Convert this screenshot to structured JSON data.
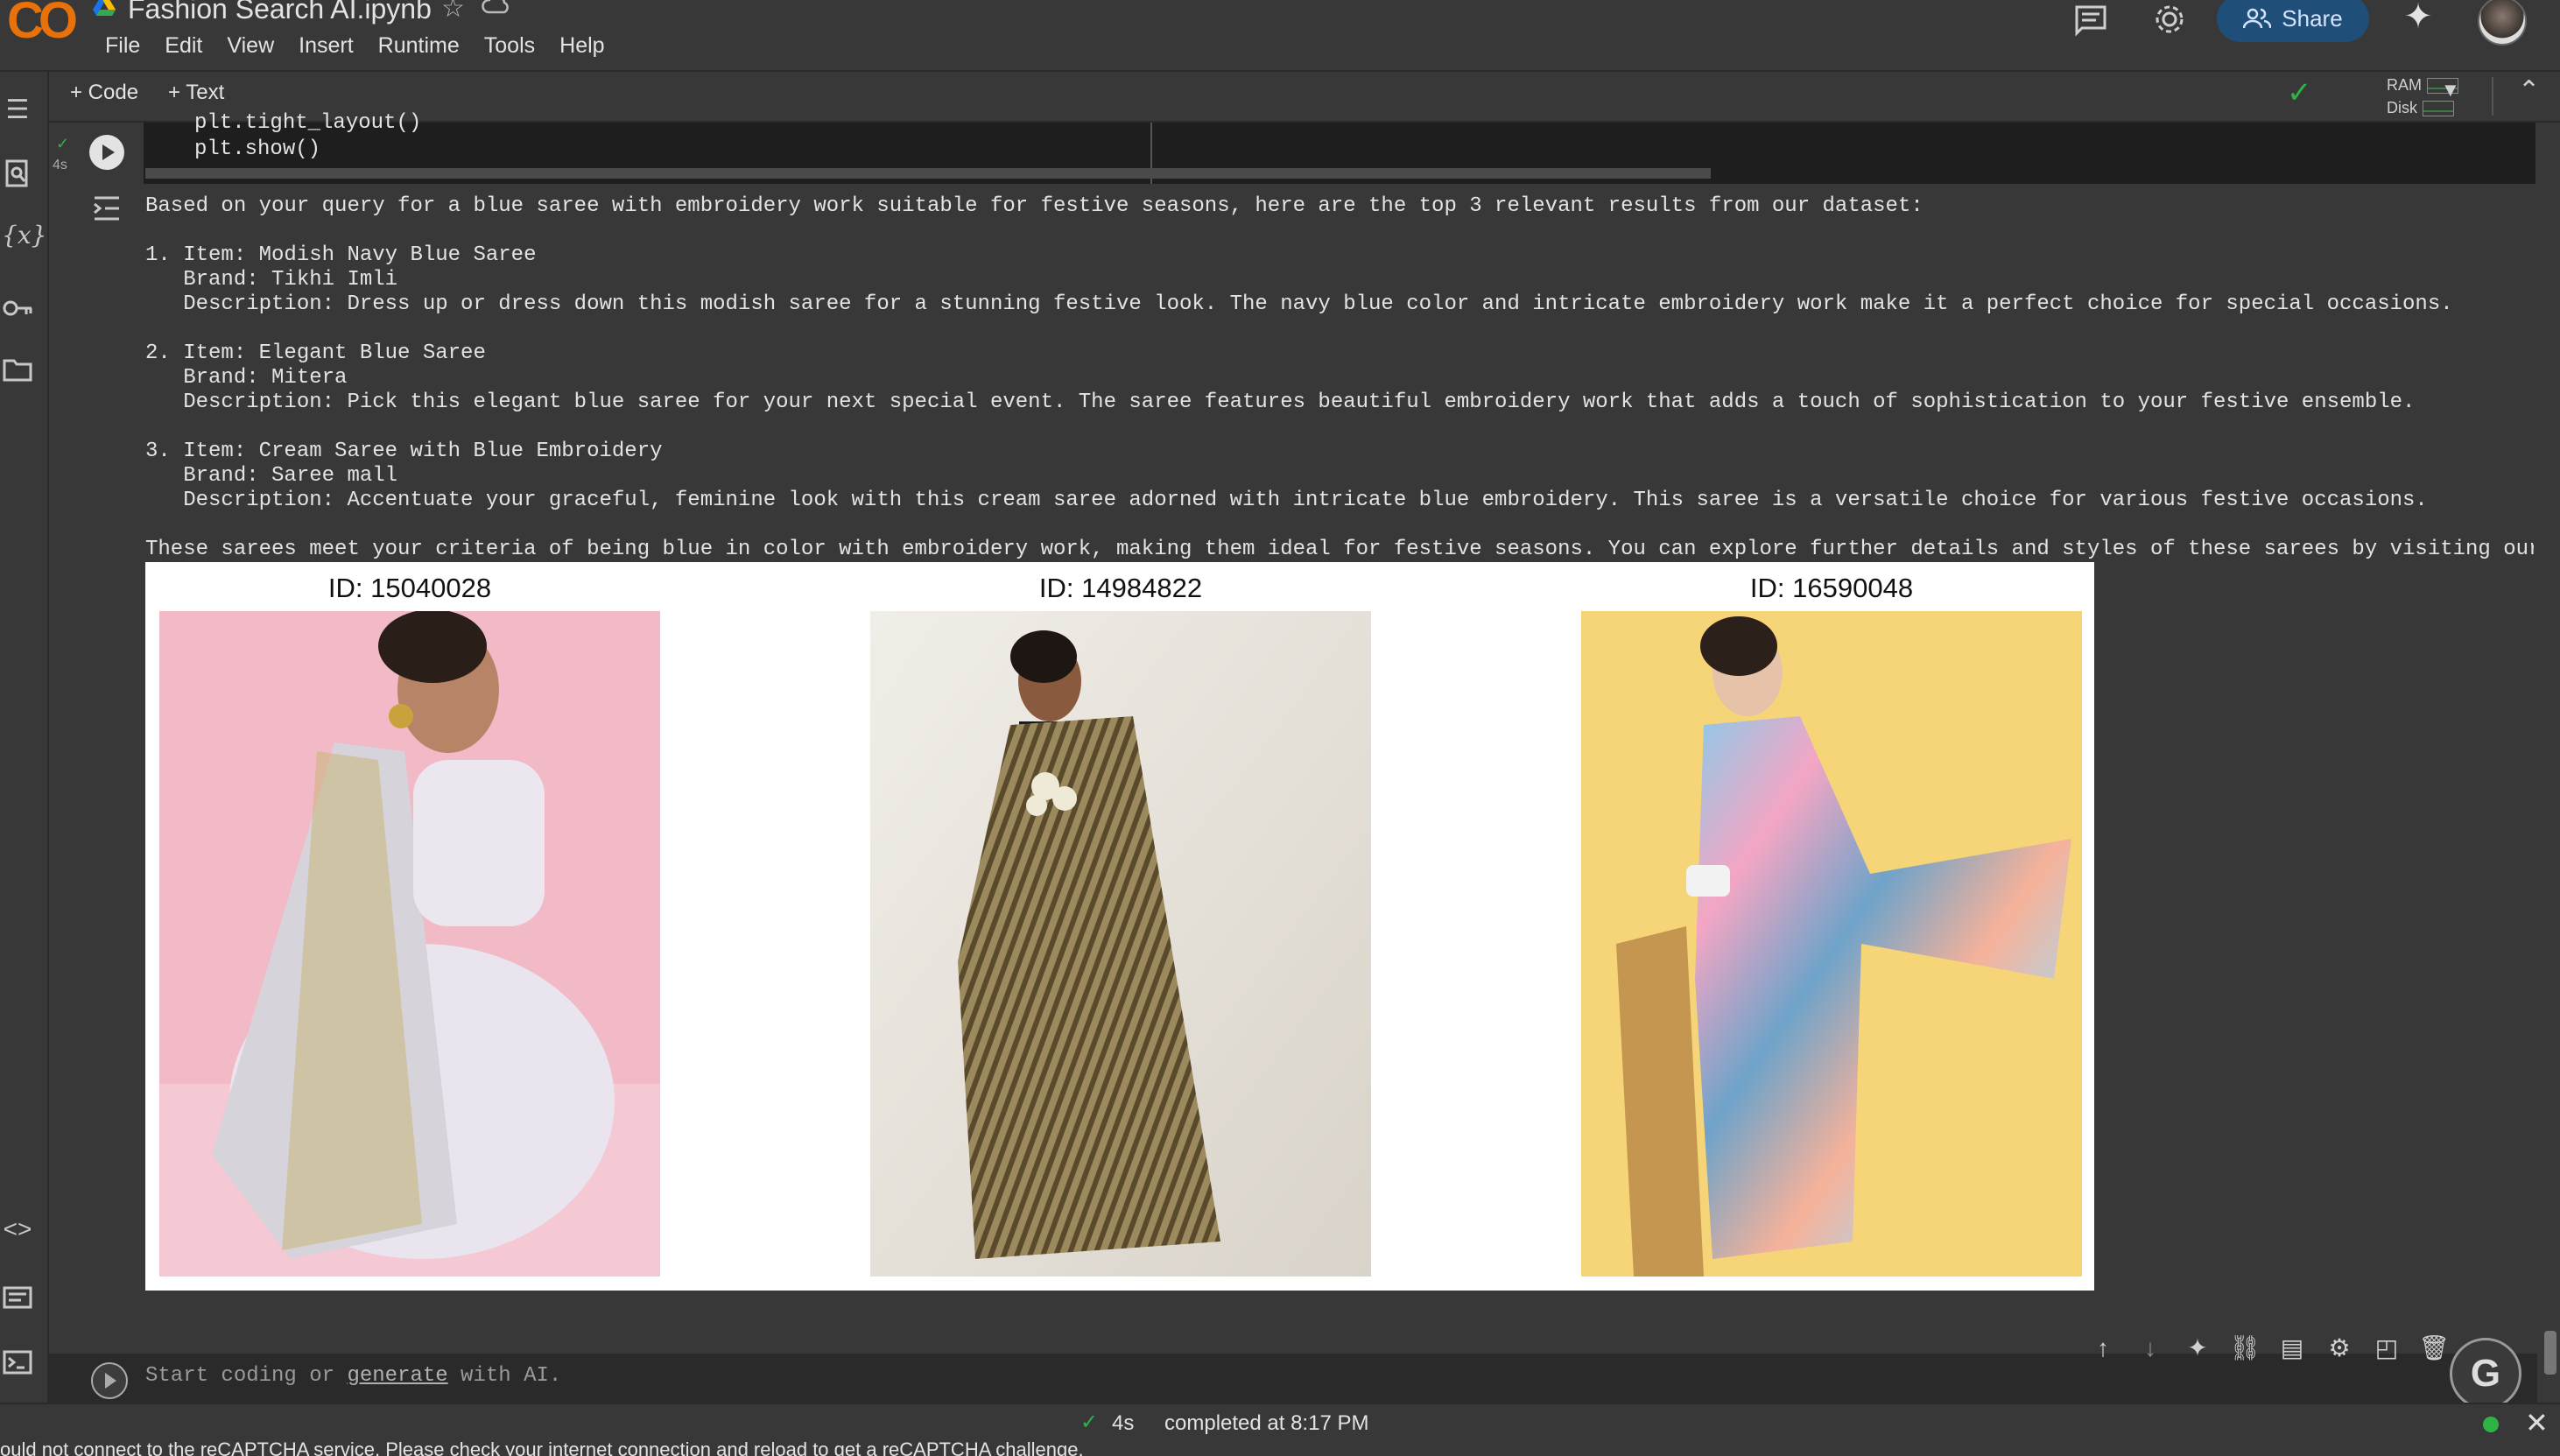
{
  "header": {
    "logo": "CO",
    "title": "Fashion Search AI.ipynb",
    "menus": [
      "File",
      "Edit",
      "View",
      "Insert",
      "Runtime",
      "Tools",
      "Help"
    ],
    "share_label": "Share"
  },
  "toolbar": {
    "add_code": "+ Code",
    "add_text": "+ Text",
    "ram_label": "RAM",
    "disk_label": "Disk"
  },
  "code_cell": {
    "exec_time": "4s",
    "lines": "plt.tight_layout()\nplt.show()"
  },
  "output": {
    "text": "Based on your query for a blue saree with embroidery work suitable for festive seasons, here are the top 3 relevant results from our dataset:\n\n1. Item: Modish Navy Blue Saree\n   Brand: Tikhi Imli\n   Description: Dress up or dress down this modish saree for a stunning festive look. The navy blue color and intricate embroidery work make it a perfect choice for special occasions.\n\n2. Item: Elegant Blue Saree\n   Brand: Mitera\n   Description: Pick this elegant blue saree for your next special event. The saree features beautiful embroidery work that adds a touch of sophistication to your festive ensemble.\n\n3. Item: Cream Saree with Blue Embroidery\n   Brand: Saree mall\n   Description: Accentuate your graceful, feminine look with this cream saree adorned with intricate blue embroidery. This saree is a versatile choice for various festive occasions.\n\nThese sarees meet your criteria of being blue in color with embroidery work, making them ideal for festive seasons. You can explore further details and styles of these sarees by visiting our",
    "images": [
      {
        "title": "ID: 15040028"
      },
      {
        "title": "ID: 14984822"
      },
      {
        "title": "ID: 16590048"
      }
    ]
  },
  "new_cell": {
    "placeholder_prefix": "Start coding or ",
    "placeholder_link": "generate",
    "placeholder_suffix": " with AI."
  },
  "status": {
    "time": "4s",
    "message": "completed at 8:17 PM"
  },
  "recaptcha_warning": "ould not connect to the reCAPTCHA service. Please check your internet connection and reload to get a reCAPTCHA challenge.",
  "colors": {
    "background": "#383838",
    "accent_green": "#2fb344",
    "share_bg": "#1f4e78",
    "logo_orange": "#f9ab00"
  }
}
